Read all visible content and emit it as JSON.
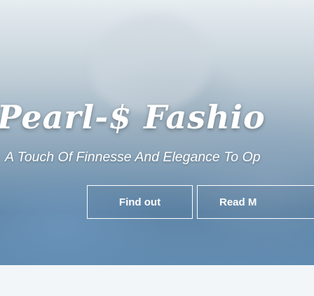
{
  "hero": {
    "brand": "Pearl-$ Fashio",
    "tagline": "A Touch Of Finnesse And Elegance To Op"
  },
  "buttons": {
    "find_label": "Find out",
    "read_label": "Read M"
  },
  "colors": {
    "text": "#ffffff",
    "below_fold": "#f3f6f8"
  }
}
